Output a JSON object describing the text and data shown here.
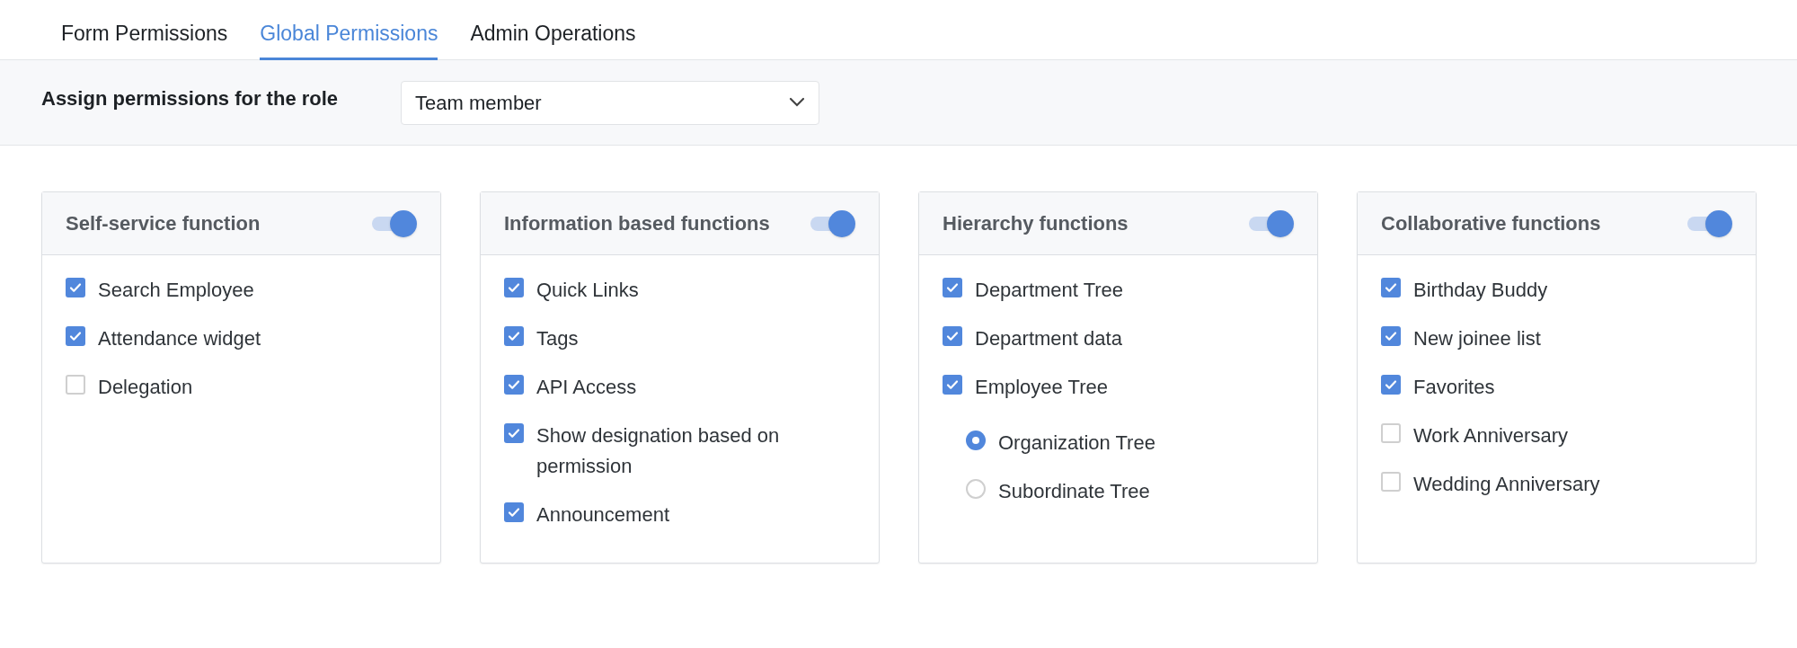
{
  "tabs": [
    {
      "label": "Form Permissions",
      "selected": false
    },
    {
      "label": "Global Permissions",
      "selected": true
    },
    {
      "label": "Admin Operations",
      "selected": false
    }
  ],
  "role_bar": {
    "label": "Assign permissions for the role",
    "dropdown_value": "Team member"
  },
  "cards": [
    {
      "title": "Self-service function",
      "on": true,
      "items": [
        {
          "kind": "checkbox",
          "label": "Search Employee",
          "checked": true
        },
        {
          "kind": "checkbox",
          "label": "Attendance widget",
          "checked": true
        },
        {
          "kind": "checkbox",
          "label": "Delegation",
          "checked": false
        }
      ]
    },
    {
      "title": "Information based functions",
      "on": true,
      "items": [
        {
          "kind": "checkbox",
          "label": "Quick Links",
          "checked": true
        },
        {
          "kind": "checkbox",
          "label": "Tags",
          "checked": true
        },
        {
          "kind": "checkbox",
          "label": "API Access",
          "checked": true
        },
        {
          "kind": "checkbox",
          "label": "Show designation based on permission",
          "checked": true
        },
        {
          "kind": "checkbox",
          "label": "Announcement",
          "checked": true
        }
      ]
    },
    {
      "title": "Hierarchy functions",
      "on": true,
      "items": [
        {
          "kind": "checkbox",
          "label": "Department Tree",
          "checked": true
        },
        {
          "kind": "checkbox",
          "label": "Department data",
          "checked": true
        },
        {
          "kind": "checkbox",
          "label": "Employee Tree",
          "checked": true,
          "children": [
            {
              "kind": "radio",
              "label": "Organization Tree",
              "selected": true
            },
            {
              "kind": "radio",
              "label": "Subordinate Tree",
              "selected": false
            }
          ]
        }
      ]
    },
    {
      "title": "Collaborative functions",
      "on": true,
      "items": [
        {
          "kind": "checkbox",
          "label": "Birthday Buddy",
          "checked": true
        },
        {
          "kind": "checkbox",
          "label": "New joinee list",
          "checked": true
        },
        {
          "kind": "checkbox",
          "label": "Favorites",
          "checked": true
        },
        {
          "kind": "checkbox",
          "label": "Work Anniversary",
          "checked": false
        },
        {
          "kind": "checkbox",
          "label": "Wedding Anniversary",
          "checked": false
        }
      ]
    }
  ]
}
